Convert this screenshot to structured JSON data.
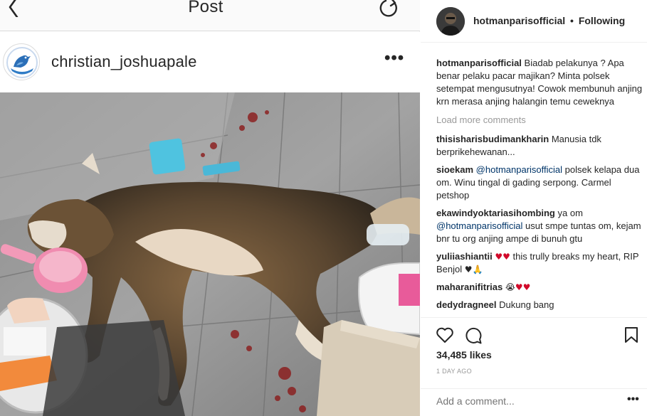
{
  "top_bar": {
    "title": "Post",
    "back_icon": "chevron-left-icon",
    "refresh_icon": "refresh-icon"
  },
  "post_header": {
    "username": "christian_joshuapale",
    "more_label": "•••"
  },
  "right_header": {
    "username": "hotmanparisofficial",
    "separator": "•",
    "follow_status": "Following"
  },
  "caption": {
    "user": "hotmanparisofficial",
    "text": "Biadab pelakunya ? Apa benar pelaku pacar majikan? Minta polsek setempat mengusutnya! Cowok membunuh anjing krn merasa anjing halangin temu ceweknya"
  },
  "load_more": "Load more comments",
  "comments": [
    {
      "user": "thisisharisbudimankharin",
      "text": "Manusia tdk berprikehewanan..."
    },
    {
      "user": "sioekam",
      "mention": "@hotmanparisofficial",
      "text": "polsek kelapa dua om. Winu tingal di gading serpong. Carmel petshop"
    },
    {
      "user": "ekawindyoktariasihombing",
      "pre": "ya om",
      "mention": "@hotmanparisofficial",
      "text": "usut smpe tuntas om, kejam bnr tu org anjing ampe di bunuh gtu"
    },
    {
      "user": "yuliiashiantii",
      "emoji1": "♥♥",
      "text": "this trully breaks my heart, RIP Benjol",
      "emoji2": "♥",
      "emoji3": "🙏"
    },
    {
      "user": "maharanifitrias",
      "emoji1": "😭",
      "emoji2": "♥♥"
    },
    {
      "user": "dedydragneel",
      "text": "Dukung bang"
    }
  ],
  "actions": {
    "likes": "34,485 likes",
    "time": "1 DAY AGO"
  },
  "add_comment": {
    "placeholder": "Add a comment...",
    "more_label": "•••"
  },
  "colors": {
    "border": "#dbdbdb",
    "text": "#262626",
    "muted": "#999999",
    "mention": "#003569",
    "heart": "#d10a2a"
  }
}
